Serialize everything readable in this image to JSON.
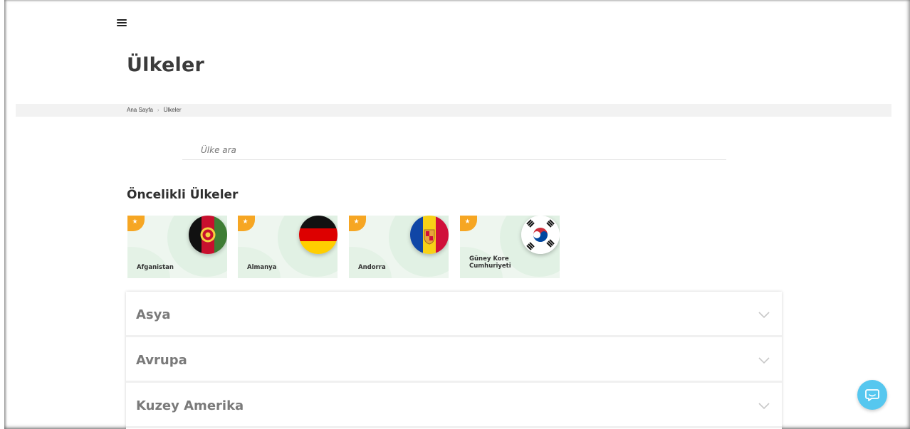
{
  "header": {
    "menu_icon": "hamburger-menu-icon",
    "page_title": "Ülkeler"
  },
  "breadcrumb": {
    "items": [
      "Ana Sayfa",
      "Ülkeler"
    ],
    "separator_icon": "chevron-right-icon"
  },
  "search": {
    "placeholder": "Ülke ara",
    "value": ""
  },
  "priority": {
    "title": "Öncelikli Ülkeler",
    "badge_icon": "star-icon",
    "cards": [
      {
        "name": "Afganistan",
        "flag_icon": "afghanistan-flag-icon"
      },
      {
        "name": "Almanya",
        "flag_icon": "germany-flag-icon"
      },
      {
        "name": "Andorra",
        "flag_icon": "andorra-flag-icon"
      },
      {
        "name": "Güney Kore Cumhuriyeti",
        "flag_icon": "south-korea-flag-icon"
      }
    ]
  },
  "regions": [
    {
      "label": "Asya"
    },
    {
      "label": "Avrupa"
    },
    {
      "label": "Kuzey Amerika"
    }
  ],
  "chat": {
    "icon": "chat-bubble-icon"
  },
  "colors": {
    "badge": "#f6a623",
    "card_bg": "#eef6ef",
    "chat": "#56c7ef"
  }
}
